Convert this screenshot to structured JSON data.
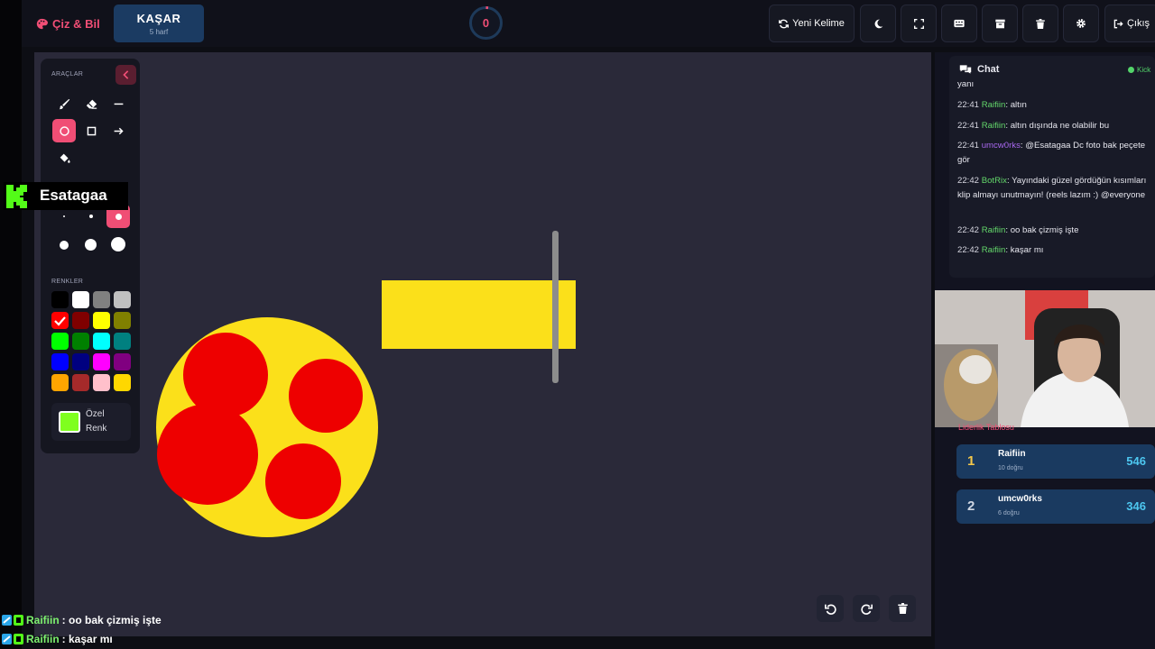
{
  "app": {
    "name": "Çiz & Bil"
  },
  "word": {
    "value": "KAŞAR",
    "hint": "5 harf"
  },
  "timer": {
    "value": "0"
  },
  "toolbar": {
    "new_word_label": "Yeni Kelime",
    "logout_label": "Çıkış",
    "icons": [
      "refresh-icon",
      "moon-icon",
      "fullscreen-icon",
      "keyboard-icon",
      "archive-icon",
      "trash-icon",
      "gear-icon",
      "logout-icon"
    ]
  },
  "tools_panel": {
    "title": "ARAÇLAR",
    "tools": [
      "brush",
      "eraser",
      "line",
      "circle",
      "rectangle",
      "arrow",
      "fill"
    ],
    "active_tool": "circle",
    "colors_title": "RENKLER",
    "colors": [
      "#000000",
      "#ffffff",
      "#808080",
      "#c0c0c0",
      "#ff0000",
      "#800000",
      "#ffff00",
      "#808000",
      "#00ff00",
      "#008000",
      "#00ffff",
      "#008080",
      "#0000ff",
      "#000080",
      "#ff00ff",
      "#800080",
      "#ffa500",
      "#a52a2a",
      "#ffc0cb",
      "#ffd700"
    ],
    "selected_color": "#ff0000",
    "custom_color": {
      "label": "Özel Renk",
      "value": "#7fff1e"
    },
    "brush_sizes_count": 6,
    "active_size_index": 2
  },
  "stream_overlay": {
    "streamer_name": "Esatagaa"
  },
  "chat": {
    "title": "Chat",
    "status": "Kick",
    "truncated_top": "yanı",
    "messages": [
      {
        "time": "22:41",
        "user": "Raifiin",
        "color": "green",
        "text": "altın"
      },
      {
        "time": "22:41",
        "user": "Raifiin",
        "color": "green",
        "text": "altın dışında ne olabilir bu"
      },
      {
        "time": "22:41",
        "user": "umcw0rks",
        "color": "purple",
        "text": "@Esatagaa Dc foto bak peçete gör"
      },
      {
        "time": "22:42",
        "user": "BotRix",
        "color": "green",
        "text": "Yayındaki güzel gördüğün kısımları klip almayı unutmayın! (reels lazım :) @everyone"
      },
      {
        "time": "22:42",
        "user": "Raifiin",
        "color": "green",
        "text": "oo bak çizmiş işte"
      },
      {
        "time": "22:42",
        "user": "Raifiin",
        "color": "green",
        "text": "kaşar mı"
      }
    ]
  },
  "leaderboard": {
    "title": "Liderlik Tablosu",
    "entries": [
      {
        "rank": "1",
        "name": "Raifiin",
        "correct": "10 doğru",
        "score": "546"
      },
      {
        "rank": "2",
        "name": "umcw0rks",
        "correct": "6 doğru",
        "score": "346"
      }
    ]
  },
  "bottom_chat": [
    {
      "user": "Raifiin",
      "text": ": oo bak çizmiş işte"
    },
    {
      "user": "Raifiin",
      "text": ": kaşar mı"
    }
  ],
  "canvas_controls": [
    "undo-icon",
    "redo-icon",
    "trash-icon"
  ],
  "colors": {
    "accent": "#f04e75",
    "primary": "#1b3b62",
    "canvas": "#2a2939",
    "score": "#4dc7f0"
  }
}
